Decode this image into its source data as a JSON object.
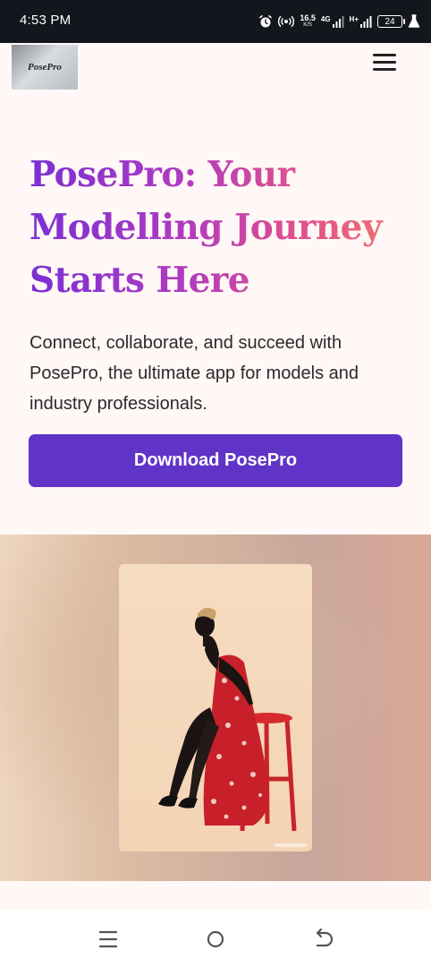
{
  "status_bar": {
    "time": "4:53 PM",
    "speed_value": "16.5",
    "speed_unit": "K/S",
    "network_4g": "4G",
    "network_hplus": "H+",
    "battery": "24",
    "icons": [
      "alarm-icon",
      "hotspot-icon",
      "signal-icon",
      "signal-icon",
      "battery-icon",
      "flask-icon"
    ]
  },
  "header": {
    "logo_text": "PosePro",
    "menu_icon": "hamburger-menu-icon"
  },
  "hero": {
    "title": "PosePro: Your Modelling Journey Starts Here",
    "description": "Connect, collaborate, and succeed with PosePro, the ultimate app for models and industry professionals.",
    "cta_label": "Download PosePro"
  },
  "colors": {
    "cta": "#6134c8",
    "title_gradient_start": "#7a2fd6",
    "title_gradient_end": "#f07a6a",
    "status_bar": "#13161c",
    "page_bg": "#fff8f6"
  },
  "nav_bar": {
    "icons": [
      "recent-apps-icon",
      "home-icon",
      "back-icon"
    ]
  }
}
